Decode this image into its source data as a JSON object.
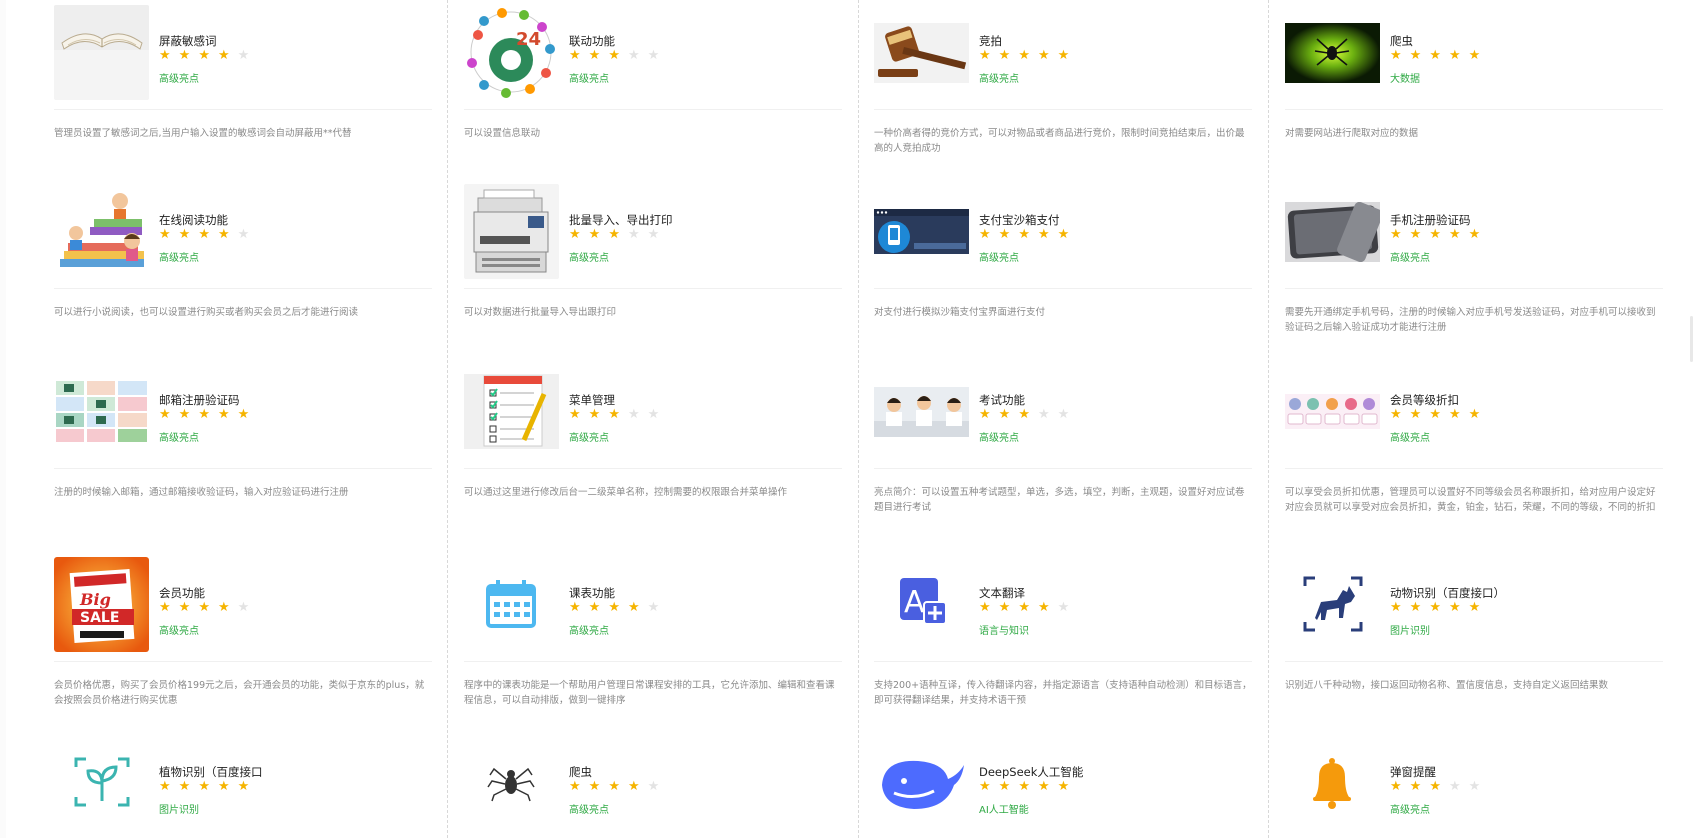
{
  "cards": [
    {
      "name": "屏蔽敏感词",
      "stars": 4,
      "tag": "高级亮点",
      "desc": "管理员设置了敏感词之后,当用户输入设置的敏感词会自动屏蔽用**代替",
      "icon": "open-book-image"
    },
    {
      "name": "联动功能",
      "stars": 3,
      "tag": "高级亮点",
      "desc": "可以设置信息联动",
      "icon": "network-diagram-image"
    },
    {
      "name": "竞拍",
      "stars": 5,
      "tag": "高级亮点",
      "desc": "一种价高者得的竞价方式，可以对物品或者商品进行竞价，限制时间竞拍结束后，出价最高的人竞拍成功",
      "icon": "gavel-image"
    },
    {
      "name": "爬虫",
      "stars": 5,
      "tag": "大数据",
      "desc": "对需要网站进行爬取对应的数据",
      "icon": "spider-glow-image"
    },
    {
      "name": "在线阅读功能",
      "stars": 4,
      "tag": "高级亮点",
      "desc": "可以进行小说阅读，也可以设置进行购买或者购买会员之后才能进行阅读",
      "icon": "kids-books-image"
    },
    {
      "name": "批量导入、导出打印",
      "stars": 3,
      "tag": "高级亮点",
      "desc": "可以对数据进行批量导入导出跟打印",
      "icon": "printer-image"
    },
    {
      "name": "支付宝沙箱支付",
      "stars": 5,
      "tag": "高级亮点",
      "desc": "对支付进行模拟沙箱支付宝界面进行支付",
      "icon": "payment-phone-image"
    },
    {
      "name": "手机注册验证码",
      "stars": 5,
      "tag": "高级亮点",
      "desc": "需要先开通绑定手机号码，注册的时候输入对应手机号发送验证码，对应手机可以接收到验证码之后输入验证成功才能进行注册",
      "icon": "smartphone-image"
    },
    {
      "name": "邮箱注册验证码",
      "stars": 5,
      "tag": "高级亮点",
      "desc": "注册的时候输入邮箱，通过邮箱接收验证码，输入对应验证码进行注册",
      "icon": "email-grid-image"
    },
    {
      "name": "菜单管理",
      "stars": 3,
      "tag": "高级亮点",
      "desc": "可以通过这里进行修改后台一二级菜单名称，控制需要的权限跟合并菜单操作",
      "icon": "checklist-image"
    },
    {
      "name": "考试功能",
      "stars": 3,
      "tag": "高级亮点",
      "desc": "亮点简介：可以设置五种考试题型，单选，多选，填空，判断，主观题，设置好对应试卷题目进行考试",
      "icon": "students-image"
    },
    {
      "name": "会员等级折扣",
      "stars": 5,
      "tag": "高级亮点",
      "desc": "可以享受会员折扣优惠，管理员可以设置好不同等级会员名称跟折扣，给对应用户设定好对应会员就可以享受对应会员折扣，黄金，铂金，钻石，荣耀，不同的等级，不同的折扣",
      "icon": "member-levels-image"
    },
    {
      "name": "会员功能",
      "stars": 4,
      "tag": "高级亮点",
      "desc": "会员价格优惠，购买了会员价格199元之后，会开通会员的功能，类似于京东的plus，就会按照会员价格进行购买优惠",
      "icon": "sale-banner-image"
    },
    {
      "name": "课表功能",
      "stars": 4,
      "tag": "高级亮点",
      "desc": "程序中的课表功能是一个帮助用户管理日常课程安排的工具，它允许添加、编辑和查看课程信息，可以自动排版，做到一键排序",
      "icon": "calendar-icon"
    },
    {
      "name": "文本翻译",
      "stars": 4,
      "tag": "语言与知识",
      "desc": "支持200+语种互译，传入待翻译内容，并指定源语言（支持语种自动检测）和目标语言，即可获得翻译结果，并支持术语干预",
      "icon": "translate-icon"
    },
    {
      "name": "动物识别（百度接口）",
      "stars": 5,
      "tag": "图片识别",
      "desc": "识别近八千种动物，接口返回动物名称、置信度信息，支持自定义返回结果数",
      "icon": "dog-scan-icon"
    },
    {
      "name": "植物识别（百度接口",
      "stars": 5,
      "tag": "图片识别",
      "desc": "",
      "icon": "plant-scan-icon"
    },
    {
      "name": "爬虫",
      "stars": 4,
      "tag": "高级亮点",
      "desc": "",
      "icon": "spider-icon"
    },
    {
      "name": "DeepSeek人工智能",
      "stars": 5,
      "tag": "AI人工智能",
      "desc": "",
      "icon": "whale-icon"
    },
    {
      "name": "弹窗提醒",
      "stars": 3,
      "tag": "高级亮点",
      "desc": "",
      "icon": "bell-icon"
    }
  ],
  "colors": {
    "star_on": "#f5b400",
    "star_off": "#e3e3e3",
    "tag": "#2fa944",
    "desc": "#8a8a8a"
  }
}
